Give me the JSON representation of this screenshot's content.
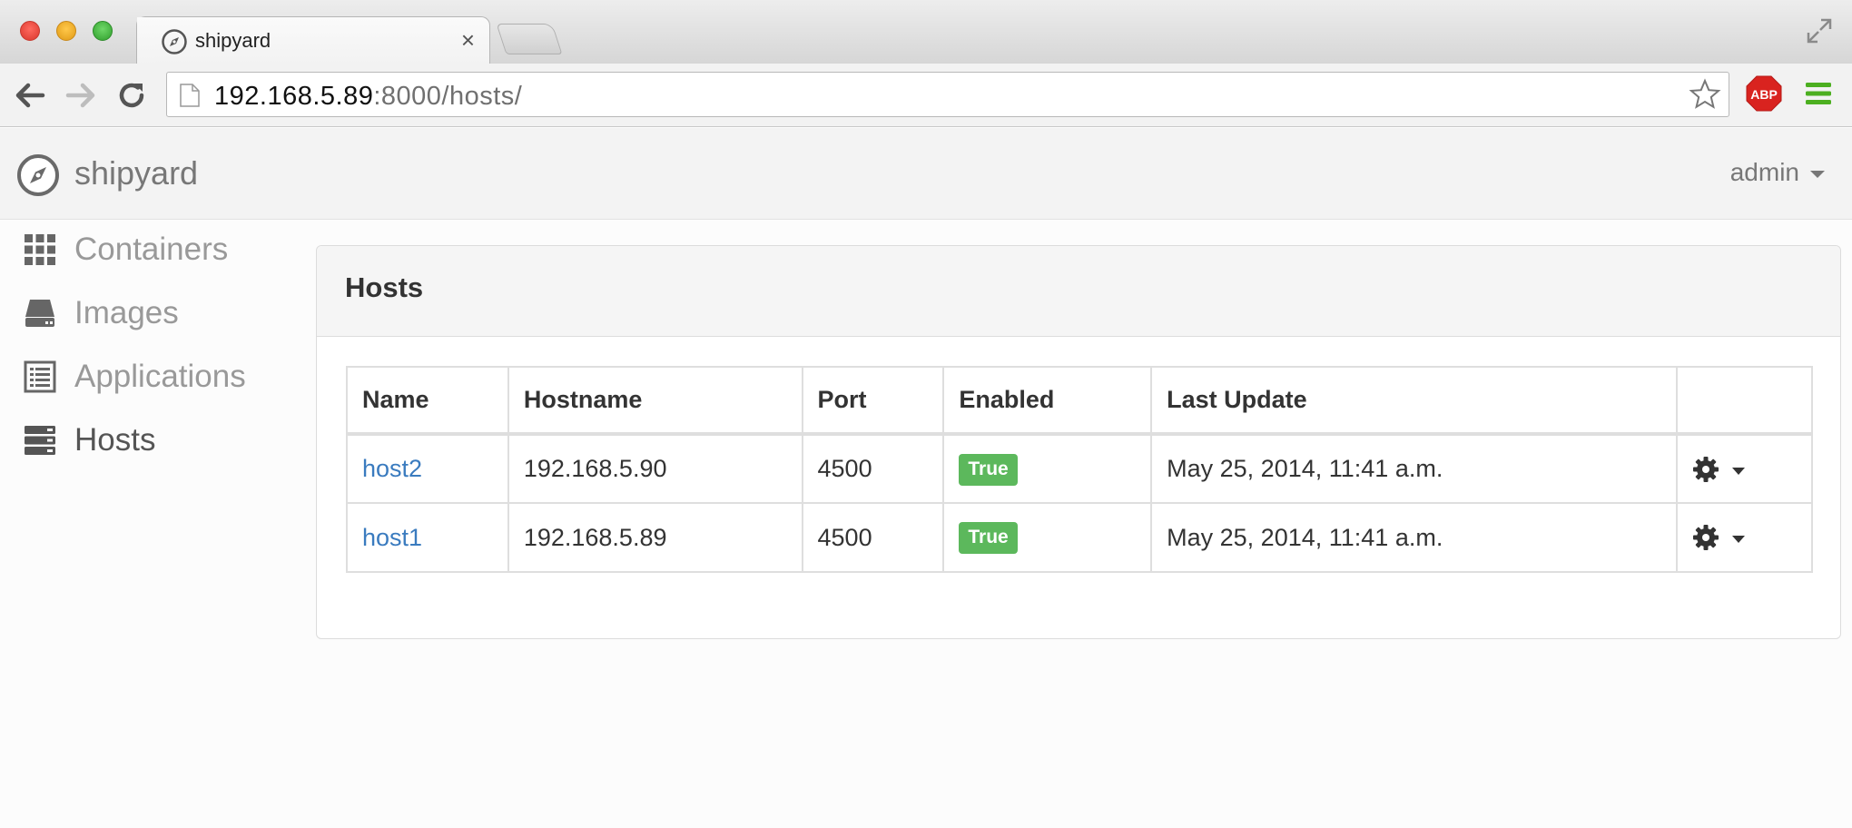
{
  "browser": {
    "tab_title": "shipyard",
    "tab_close_glyph": "×",
    "url_host": "192.168.5.89",
    "url_rest": ":8000/hosts/",
    "extension_label": "ABP"
  },
  "app": {
    "brand": "shipyard",
    "user": "admin"
  },
  "sidebar": {
    "items": [
      {
        "label": "Containers",
        "icon": "grid-icon",
        "active": false
      },
      {
        "label": "Images",
        "icon": "hard-drive-icon",
        "active": false
      },
      {
        "label": "Applications",
        "icon": "list-icon",
        "active": false
      },
      {
        "label": "Hosts",
        "icon": "server-icon",
        "active": true
      }
    ]
  },
  "panel": {
    "title": "Hosts",
    "columns": [
      "Name",
      "Hostname",
      "Port",
      "Enabled",
      "Last Update",
      ""
    ],
    "rows": [
      {
        "name": "host2",
        "hostname": "192.168.5.90",
        "port": "4500",
        "enabled": "True",
        "last_update": "May 25, 2014, 11:41 a.m."
      },
      {
        "name": "host1",
        "hostname": "192.168.5.89",
        "port": "4500",
        "enabled": "True",
        "last_update": "May 25, 2014, 11:41 a.m."
      }
    ]
  },
  "colors": {
    "link": "#3a7bbf",
    "badge_success": "#5cb85c",
    "abp_red": "#d9231f",
    "menu_green": "#4caf20"
  }
}
